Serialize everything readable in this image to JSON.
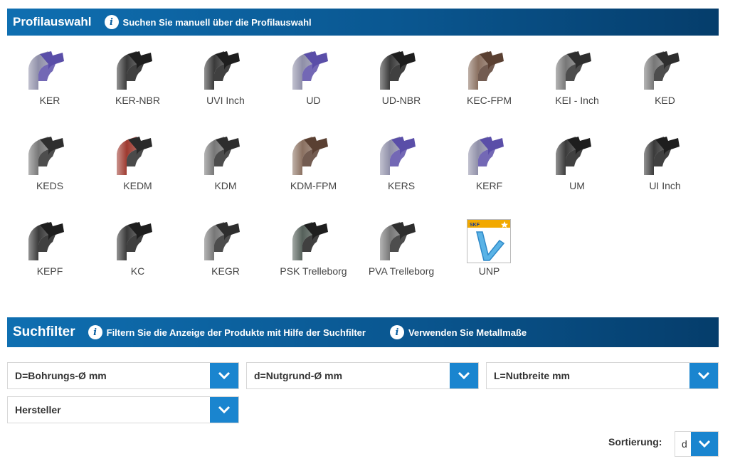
{
  "profil_header": {
    "title": "Profilauswahl",
    "info_text": "Suchen Sie manuell über die Profilauswahl"
  },
  "profiles": [
    {
      "label": "KER",
      "icon": "seal-profile-purple-icon"
    },
    {
      "label": "KER-NBR",
      "icon": "seal-profile-black-icon"
    },
    {
      "label": "UVI Inch",
      "icon": "seal-profile-black-icon"
    },
    {
      "label": "UD",
      "icon": "seal-profile-purple-icon"
    },
    {
      "label": "UD-NBR",
      "icon": "seal-profile-black-icon"
    },
    {
      "label": "KEC-FPM",
      "icon": "seal-profile-brown-icon"
    },
    {
      "label": "KEI - Inch",
      "icon": "seal-profile-grey-icon"
    },
    {
      "label": "KED",
      "icon": "seal-profile-grey-icon"
    },
    {
      "label": "KEDS",
      "icon": "seal-profile-grey-icon"
    },
    {
      "label": "KEDM",
      "icon": "seal-profile-red-icon"
    },
    {
      "label": "KDM",
      "icon": "seal-profile-grey-icon"
    },
    {
      "label": "KDM-FPM",
      "icon": "seal-profile-brown-icon"
    },
    {
      "label": "KERS",
      "icon": "seal-profile-purple-icon"
    },
    {
      "label": "KERF",
      "icon": "seal-profile-purple-icon"
    },
    {
      "label": "UM",
      "icon": "seal-profile-black-icon"
    },
    {
      "label": "UI Inch",
      "icon": "seal-profile-black-icon"
    },
    {
      "label": "KEPF",
      "icon": "seal-profile-black-icon"
    },
    {
      "label": "KC",
      "icon": "seal-profile-black-icon"
    },
    {
      "label": "KEGR",
      "icon": "seal-profile-grey-icon"
    },
    {
      "label": "PSK Trelleborg",
      "icon": "seal-profile-darkgreen-icon"
    },
    {
      "label": "PVA Trelleborg",
      "icon": "seal-profile-grey-icon"
    },
    {
      "label": "UNP",
      "icon": "skf-unp-icon",
      "brand_text": "SKF"
    }
  ],
  "filter_header": {
    "title": "Suchfilter",
    "info_text_1": "Filtern Sie die Anzeige der Produkte mit Hilfe der Suchfilter",
    "info_text_2": "Verwenden Sie Metallmaße"
  },
  "filters": {
    "bore": "D=Bohrungs-Ø mm",
    "groove": "d=Nutgrund-Ø mm",
    "width": "L=Nutbreite mm",
    "manufacturer": "Hersteller"
  },
  "sort": {
    "label": "Sortierung:",
    "value": "d"
  },
  "colors": {
    "header_start": "#0f6fb1",
    "header_end": "#053d6b",
    "dropdown_button": "#1a85cf",
    "purple": "#5a4ea8",
    "red": "#a33a2c",
    "brown": "#6b5344",
    "black": "#2b2b2b",
    "grey": "#5a5a5a"
  }
}
